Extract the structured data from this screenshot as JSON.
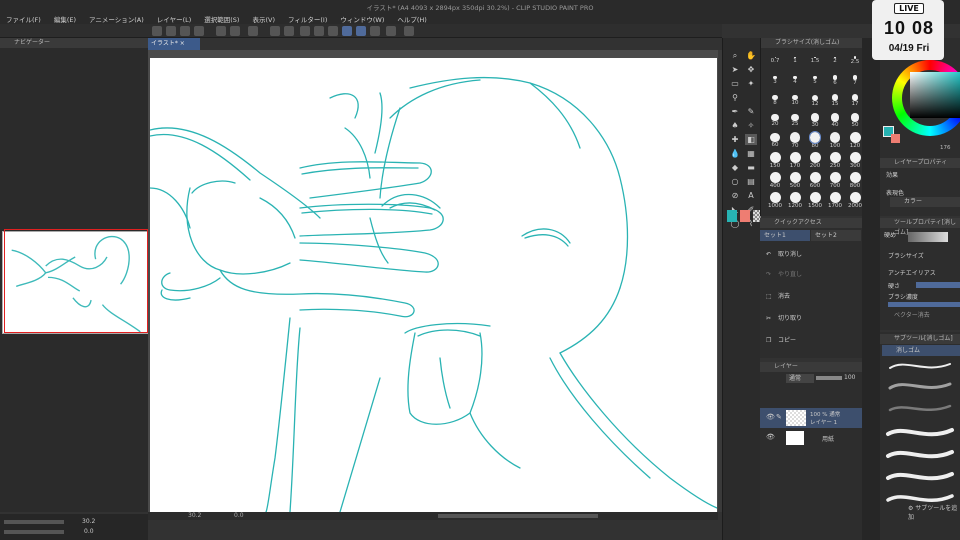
{
  "window": {
    "title": "イラスト* (A4 4093 x 2894px 350dpi 30.2%) - CLIP STUDIO PAINT PRO"
  },
  "menu": {
    "items": [
      "ファイル(F)",
      "編集(E)",
      "アニメーション(A)",
      "レイヤー(L)",
      "選択範囲(S)",
      "表示(V)",
      "フィルター(I)",
      "ウィンドウ(W)",
      "ヘルプ(H)"
    ]
  },
  "navigator": {
    "title": "ナビゲーター",
    "zoom": "30.2",
    "rotation": "0.0"
  },
  "canvas": {
    "tab_label": "イラスト*",
    "status_zoom": "30.2",
    "status_angle": "0.0",
    "stroke_color": "#2ab3b3"
  },
  "brush_size": {
    "title": "ブラシサイズ(消しゴム)",
    "sizes": [
      "0.7",
      "1",
      "1.5",
      "2",
      "2.5",
      "3",
      "4",
      "5",
      "6",
      "7",
      "8",
      "10",
      "12",
      "15",
      "17",
      "20",
      "25",
      "30",
      "40",
      "50",
      "60",
      "70",
      "80",
      "100",
      "120",
      "150",
      "170",
      "200",
      "250",
      "300",
      "400",
      "500",
      "600",
      "700",
      "800",
      "1000",
      "1200",
      "1500",
      "1700",
      "2000"
    ],
    "selected": "80"
  },
  "quick_access": {
    "title": "クイックアクセス",
    "tabs": [
      "セット1",
      "セット2"
    ],
    "items": [
      "取り消し",
      "やり直し",
      "消去",
      "切り取り",
      "コピー"
    ]
  },
  "layer": {
    "title": "レイヤー",
    "blend_mode": "通常",
    "opacity": "100",
    "layers": [
      {
        "name": "100 % 通常",
        "sub": "レイヤー 1"
      },
      {
        "name": "用紙",
        "sub": ""
      }
    ]
  },
  "color": {
    "main": "#27b3b3",
    "sub": "#ee7d72",
    "readout": "176"
  },
  "layer_property": {
    "title": "レイヤープロパティ",
    "effect_label": "効果",
    "expression_label": "表現色",
    "expression_value": "カラー"
  },
  "tool_property": {
    "title": "ツールプロパティ[消しゴム]",
    "preset": "硬め",
    "rows": [
      "ブラシサイズ",
      "アンチエイリアス",
      "硬さ",
      "ブラシ濃度",
      "ベクター消去"
    ]
  },
  "sub_tool": {
    "title": "サブツール[消しゴム]",
    "selected": "消しゴム",
    "add_label": "サブツールを追加"
  },
  "live": {
    "badge": "LIVE",
    "time": "10 08",
    "date": "04/19 Fri"
  }
}
